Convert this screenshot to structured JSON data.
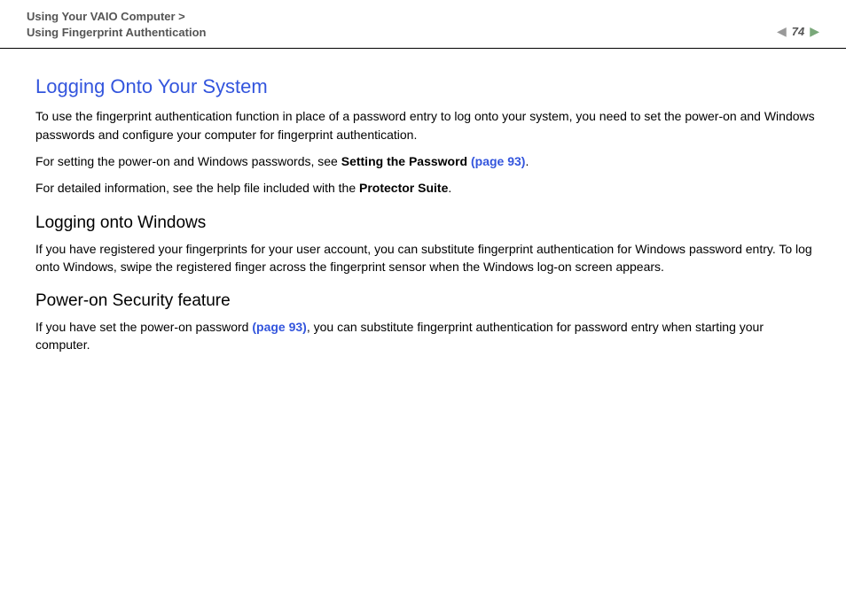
{
  "header": {
    "breadcrumb_line1": "Using Your VAIO Computer >",
    "breadcrumb_line2": "Using Fingerprint Authentication",
    "page_number": "74"
  },
  "main": {
    "title": "Logging Onto Your System",
    "p1": "To use the fingerprint authentication function in place of a password entry to log onto your system, you need to set the power-on and Windows passwords and configure your computer for fingerprint authentication.",
    "p2_a": "For setting the power-on and Windows passwords, see ",
    "p2_bold": "Setting the Password ",
    "p2_link": "(page 93)",
    "p2_c": ".",
    "p3_a": "For detailed information, see the help file included with the ",
    "p3_bold": "Protector Suite",
    "p3_c": ".",
    "sub1": "Logging onto Windows",
    "p4": "If you have registered your fingerprints for your user account, you can substitute fingerprint authentication for Windows password entry. To log onto Windows, swipe the registered finger across the fingerprint sensor when the Windows log-on screen appears.",
    "sub2": "Power-on Security feature",
    "p5_a": "If you have set the power-on password ",
    "p5_link": "(page 93)",
    "p5_b": ", you can substitute fingerprint authentication for password entry when starting your computer."
  }
}
